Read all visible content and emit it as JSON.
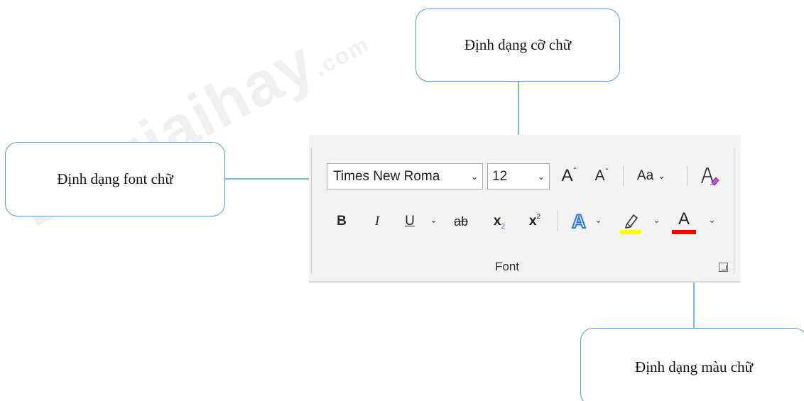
{
  "watermark": {
    "text": "Loigiaihay",
    "suffix": ".com"
  },
  "callouts": {
    "size": "Định dạng cỡ chữ",
    "font": "Định dạng font chữ",
    "color": "Định dạng màu chữ"
  },
  "ribbon": {
    "font_name": "Times New Roma",
    "font_size": "12",
    "grow_font": "A",
    "shrink_font": "A",
    "change_case": "Aa",
    "bold": "B",
    "italic": "I",
    "underline": "U",
    "strikethrough": "ab",
    "subscript": "x",
    "subscript_mark": "2",
    "superscript": "x",
    "superscript_mark": "2",
    "text_effects": "A",
    "font_color": "A",
    "group_label": "Font"
  },
  "colors": {
    "arrow": "#5b9bd5",
    "highlight": "#ffff00",
    "font_color_bar": "#ff0000",
    "text_effect_blue": "#2e75d6"
  }
}
